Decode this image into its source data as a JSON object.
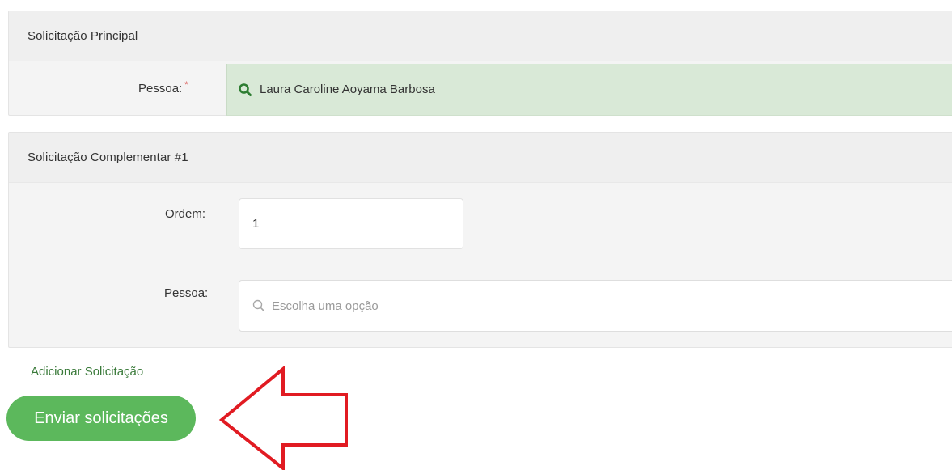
{
  "principal": {
    "title": "Solicitação Principal",
    "pessoa_label": "Pessoa:",
    "required_mark": "*",
    "pessoa_value": "Laura Caroline Aoyama Barbosa"
  },
  "complementar": {
    "title": "Solicitação Complementar #1",
    "ordem_label": "Ordem:",
    "ordem_value": "1",
    "pessoa_label": "Pessoa:",
    "pessoa_placeholder": "Escolha uma opção"
  },
  "actions": {
    "add_link": "Adicionar Solicitação",
    "send_button": "Enviar solicitações"
  },
  "icons": {
    "selected_search": "search-icon",
    "placeholder_search": "search-icon"
  },
  "colors": {
    "selected_field_bg": "#d9e9d7",
    "icon_green": "#2e7d32",
    "send_button_bg": "#5cb85c",
    "link_green": "#3a7a3a",
    "annotation_red": "#e11b22"
  }
}
